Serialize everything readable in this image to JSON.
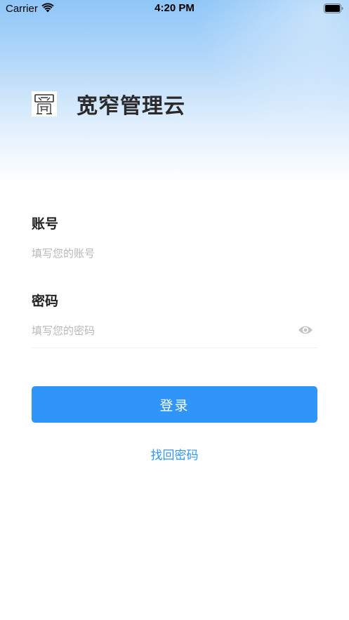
{
  "status_bar": {
    "carrier": "Carrier",
    "time": "4:20 PM",
    "wifi_icon": "wifi-icon",
    "battery_icon": "battery-full-icon"
  },
  "brand": {
    "title": "宽窄管理云",
    "logo_icon": "app-logo"
  },
  "form": {
    "account_label": "账号",
    "account_placeholder": "填写您的账号",
    "account_value": "",
    "password_label": "密码",
    "password_placeholder": "填写您的密码",
    "password_value": "",
    "visibility_icon": "eye-icon"
  },
  "actions": {
    "login_label": "登录",
    "forgot_label": "找回密码"
  },
  "colors": {
    "accent": "#2f95f8",
    "hero_gradient_top": "#8ec6f7",
    "text_primary": "#222222",
    "placeholder": "#b8b8b8"
  }
}
